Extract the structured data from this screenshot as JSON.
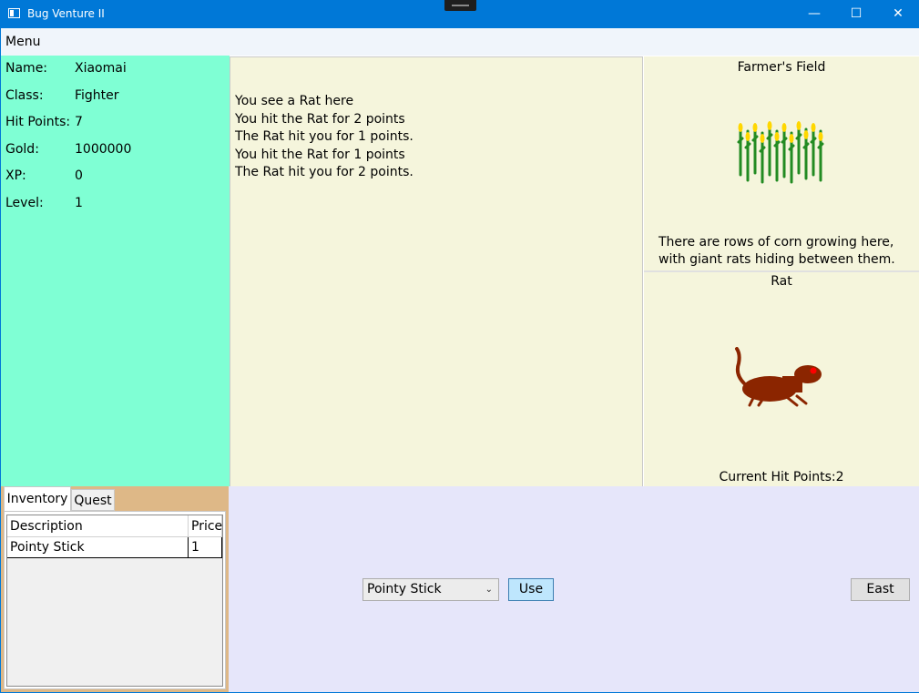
{
  "window": {
    "title": "Bug Venture II",
    "minimize_glyph": "—",
    "maximize_glyph": "☐",
    "close_glyph": "✕"
  },
  "menu": {
    "label": "Menu"
  },
  "player": {
    "rows": [
      {
        "label": "Name:",
        "value": "Xiaomai"
      },
      {
        "label": "Class:",
        "value": "Fighter"
      },
      {
        "label": "Hit Points:",
        "value": "7"
      },
      {
        "label": "Gold:",
        "value": "1000000"
      },
      {
        "label": "XP:",
        "value": "0"
      },
      {
        "label": "Level:",
        "value": "1"
      }
    ]
  },
  "messages": [
    "You see a Rat here",
    "You hit the Rat for 2 points",
    "The Rat hit you for 1 points.",
    "You hit the Rat for 1 points",
    "The Rat hit you for 2 points."
  ],
  "location": {
    "name": "Farmer's Field",
    "description": "There are rows of corn growing here, with giant rats hiding between them.",
    "image_icon": "corn-field-icon"
  },
  "monster": {
    "name": "Rat",
    "hit_points_text": "Current Hit Points:2",
    "image_icon": "rat-icon"
  },
  "tabs": {
    "inventory": "Inventory",
    "quest": "Quest"
  },
  "inventory": {
    "headers": {
      "description": "Description",
      "price": "Price"
    },
    "rows": [
      {
        "description": "Pointy Stick",
        "price": "1"
      }
    ]
  },
  "actions": {
    "weapon_selected": "Pointy Stick",
    "use_label": "Use",
    "east_label": "East"
  },
  "colors": {
    "title_bar": "#0078d7",
    "stats_bg": "#7fffd4",
    "panel_bg": "#f5f5dc",
    "tab_strip_bg": "#deb887",
    "actions_bg": "#e6e6fa",
    "corn_stalk": "#228b22",
    "corn_cob": "#ffd700",
    "rat_body": "#8b2500",
    "rat_eye": "#ff0000"
  }
}
